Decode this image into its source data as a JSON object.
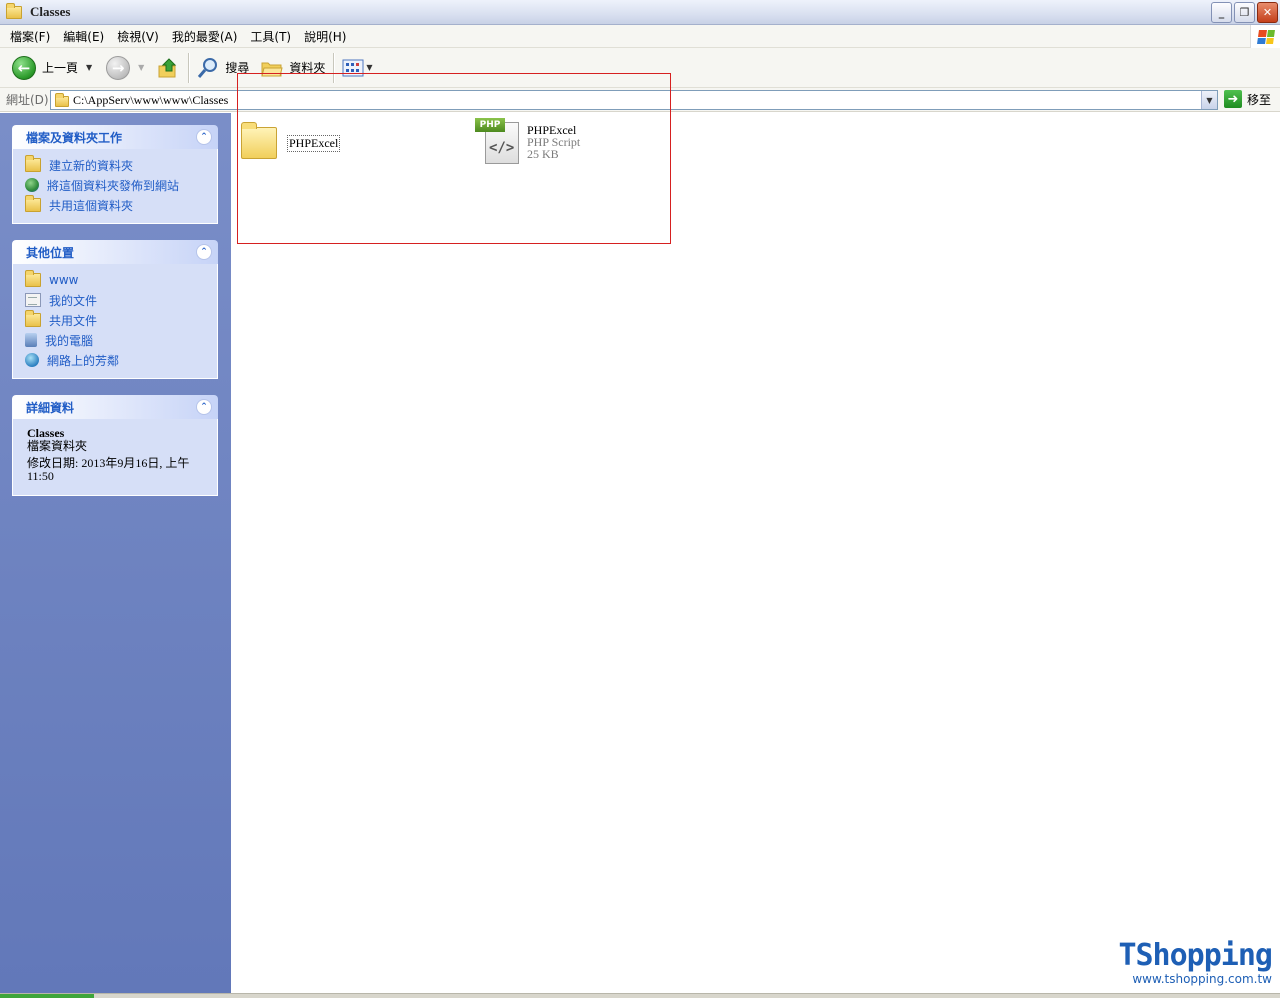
{
  "window": {
    "title": "Classes"
  },
  "menu": [
    "檔案(F)",
    "編輯(E)",
    "檢視(V)",
    "我的最愛(A)",
    "工具(T)",
    "說明(H)"
  ],
  "toolbar": {
    "back": "上一頁",
    "search": "搜尋",
    "folders": "資料夾"
  },
  "address": {
    "label": "網址(D)",
    "path": "C:\\AppServ\\www\\www\\Classes",
    "go": "移至"
  },
  "panels": {
    "tasks": {
      "title": "檔案及資料夾工作",
      "items": [
        "建立新的資料夾",
        "將這個資料夾發佈到網站",
        "共用這個資料夾"
      ]
    },
    "places": {
      "title": "其他位置",
      "items": [
        "www",
        "我的文件",
        "共用文件",
        "我的電腦",
        "網路上的芳鄰"
      ]
    },
    "details": {
      "title": "詳細資料",
      "name": "Classes",
      "type": "檔案資料夾",
      "modified": "修改日期: 2013年9月16日, 上午 11:50"
    }
  },
  "files": [
    {
      "name": "PHPExcel",
      "kind": "folder"
    },
    {
      "name": "PHPExcel",
      "type": "PHP Script",
      "size": "25 KB",
      "badge": "PHP",
      "kind": "php"
    }
  ],
  "watermark": {
    "logo": "TShopping",
    "url": "www.tshopping.com.tw"
  },
  "colors": {
    "task_link": "#215dc6",
    "highlight_box": "#d62020",
    "watermark": "#1e5fb5"
  }
}
